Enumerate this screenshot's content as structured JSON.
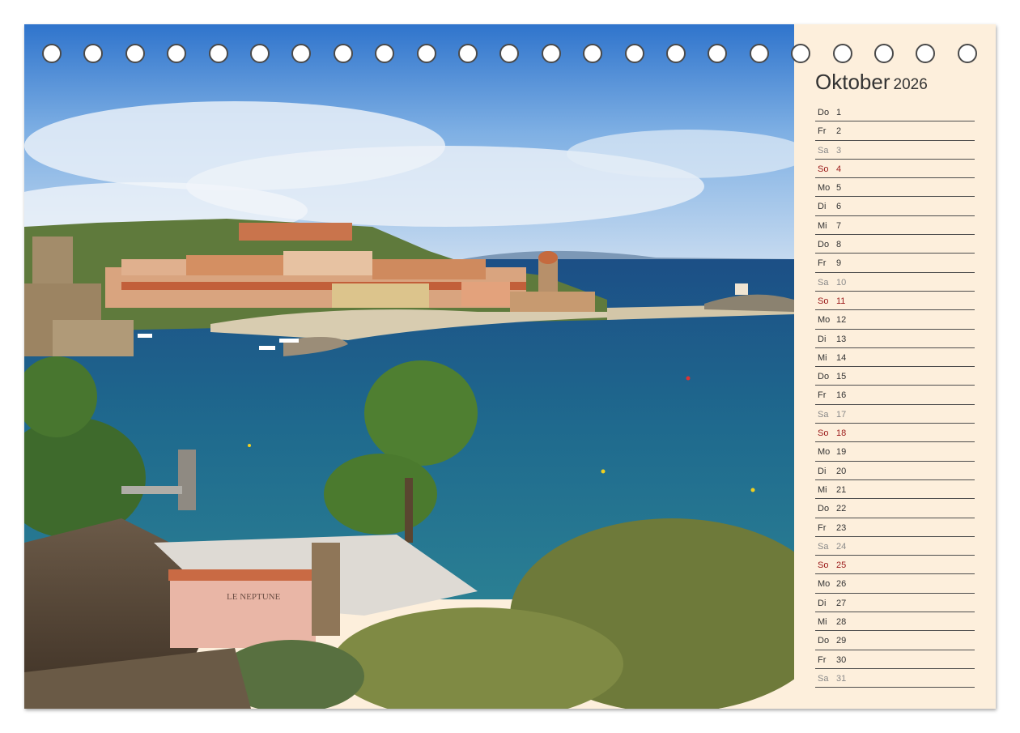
{
  "calendar": {
    "month": "Oktober",
    "year": "2026",
    "days": [
      {
        "wd": "Do",
        "d": "1",
        "type": "weekday"
      },
      {
        "wd": "Fr",
        "d": "2",
        "type": "weekday"
      },
      {
        "wd": "Sa",
        "d": "3",
        "type": "sat"
      },
      {
        "wd": "So",
        "d": "4",
        "type": "sun"
      },
      {
        "wd": "Mo",
        "d": "5",
        "type": "weekday"
      },
      {
        "wd": "Di",
        "d": "6",
        "type": "weekday"
      },
      {
        "wd": "Mi",
        "d": "7",
        "type": "weekday"
      },
      {
        "wd": "Do",
        "d": "8",
        "type": "weekday"
      },
      {
        "wd": "Fr",
        "d": "9",
        "type": "weekday"
      },
      {
        "wd": "Sa",
        "d": "10",
        "type": "sat"
      },
      {
        "wd": "So",
        "d": "11",
        "type": "sun"
      },
      {
        "wd": "Mo",
        "d": "12",
        "type": "weekday"
      },
      {
        "wd": "Di",
        "d": "13",
        "type": "weekday"
      },
      {
        "wd": "Mi",
        "d": "14",
        "type": "weekday"
      },
      {
        "wd": "Do",
        "d": "15",
        "type": "weekday"
      },
      {
        "wd": "Fr",
        "d": "16",
        "type": "weekday"
      },
      {
        "wd": "Sa",
        "d": "17",
        "type": "sat"
      },
      {
        "wd": "So",
        "d": "18",
        "type": "sun"
      },
      {
        "wd": "Mo",
        "d": "19",
        "type": "weekday"
      },
      {
        "wd": "Di",
        "d": "20",
        "type": "weekday"
      },
      {
        "wd": "Mi",
        "d": "21",
        "type": "weekday"
      },
      {
        "wd": "Do",
        "d": "22",
        "type": "weekday"
      },
      {
        "wd": "Fr",
        "d": "23",
        "type": "weekday"
      },
      {
        "wd": "Sa",
        "d": "24",
        "type": "sat"
      },
      {
        "wd": "So",
        "d": "25",
        "type": "sun"
      },
      {
        "wd": "Mo",
        "d": "26",
        "type": "weekday"
      },
      {
        "wd": "Di",
        "d": "27",
        "type": "weekday"
      },
      {
        "wd": "Mi",
        "d": "28",
        "type": "weekday"
      },
      {
        "wd": "Do",
        "d": "29",
        "type": "weekday"
      },
      {
        "wd": "Fr",
        "d": "30",
        "type": "weekday"
      },
      {
        "wd": "Sa",
        "d": "31",
        "type": "sat"
      }
    ]
  },
  "photo": {
    "sign_text": "LE NEPTUNE"
  },
  "colors": {
    "panel_background": "#fdefdc",
    "sunday": "#9b1a1a",
    "saturday": "#8a8a8a",
    "weekday": "#333333",
    "sea": "#1f5f86",
    "sky": "#3a7fd0"
  },
  "binding": {
    "ring_count": 23
  }
}
